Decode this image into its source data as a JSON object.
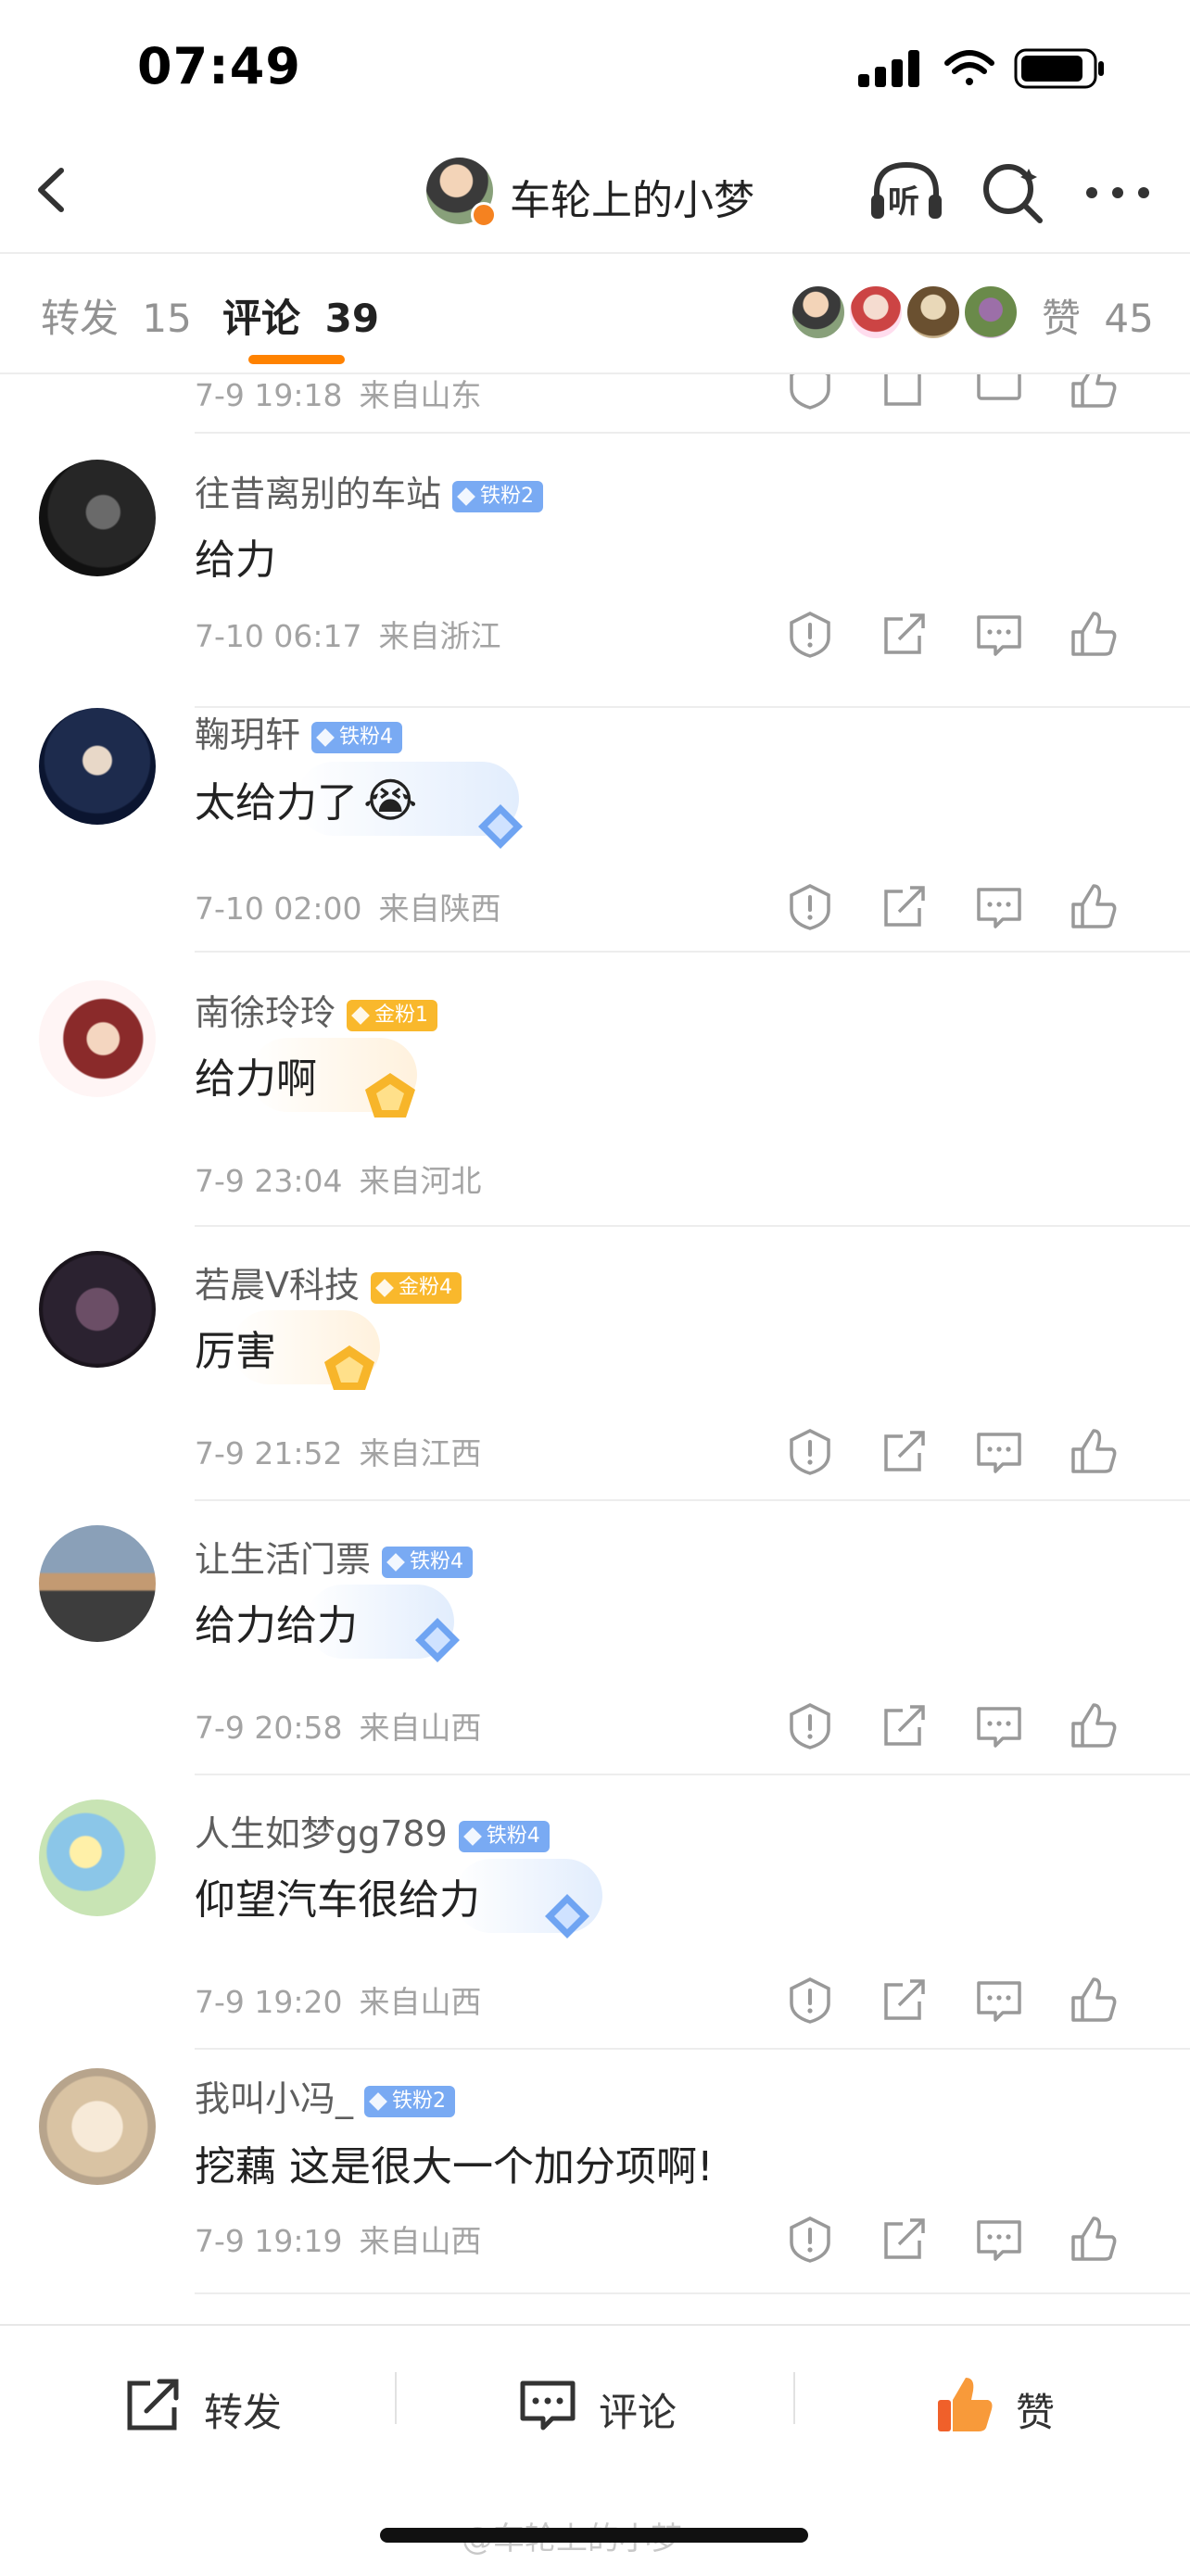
{
  "status_bar": {
    "time": "07:49"
  },
  "nav": {
    "title": "车轮上的小梦",
    "icons": [
      "back-icon",
      "headphones-icon",
      "search-icon",
      "more-icon"
    ],
    "listen_label": "听"
  },
  "tabs": [
    {
      "label": "转发",
      "count": "15",
      "active": false
    },
    {
      "label": "评论",
      "count": "39",
      "active": true
    }
  ],
  "likes": {
    "label": "赞",
    "count": "45"
  },
  "partial_comment": {
    "time": "7-9 19:18",
    "location": "来自山东"
  },
  "comments": [
    {
      "name": "往昔离别的车站",
      "badge": "铁粉2",
      "badge_type": "iron",
      "text": "给力",
      "emoji": "",
      "time": "7-10 06:17",
      "location": "来自浙江"
    },
    {
      "name": "鞠玥轩",
      "badge": "铁粉4",
      "badge_type": "iron",
      "text": "太给力了",
      "emoji": "😭",
      "time": "7-10 02:00",
      "location": "来自陕西"
    },
    {
      "name": "南徐玲玲",
      "badge": "金粉1",
      "badge_type": "gold",
      "text": "给力啊",
      "emoji": "",
      "time": "7-9 23:04",
      "location": "来自河北"
    },
    {
      "name": "若晨V科技",
      "badge": "金粉4",
      "badge_type": "gold",
      "text": "厉害",
      "emoji": "",
      "time": "7-9 21:52",
      "location": "来自江西"
    },
    {
      "name": "让生活门票",
      "badge": "铁粉4",
      "badge_type": "iron",
      "text": "给力给力",
      "emoji": "",
      "time": "7-9 20:58",
      "location": "来自山西"
    },
    {
      "name": "人生如梦gg789",
      "badge": "铁粉4",
      "badge_type": "iron",
      "text": "仰望汽车很给力",
      "emoji": "",
      "time": "7-9 19:20",
      "location": "来自山西"
    },
    {
      "name": "我叫小冯_",
      "badge": "铁粉2",
      "badge_type": "iron",
      "text": "挖藕 这是很大一个加分项啊!",
      "emoji": "",
      "time": "7-9 19:19",
      "location": "来自山西"
    }
  ],
  "comment_actions": [
    "report-icon",
    "repost-icon",
    "reply-icon",
    "like-icon"
  ],
  "bottom_bar": {
    "repost": "转发",
    "comment": "评论",
    "like": "赞"
  },
  "watermark": "@车轮上的小梦",
  "colors": {
    "accent": "#ff8200",
    "iron_badge": "#79aaf3",
    "gold_badge": "#f9b82c",
    "like_orange": "#f0602a"
  }
}
